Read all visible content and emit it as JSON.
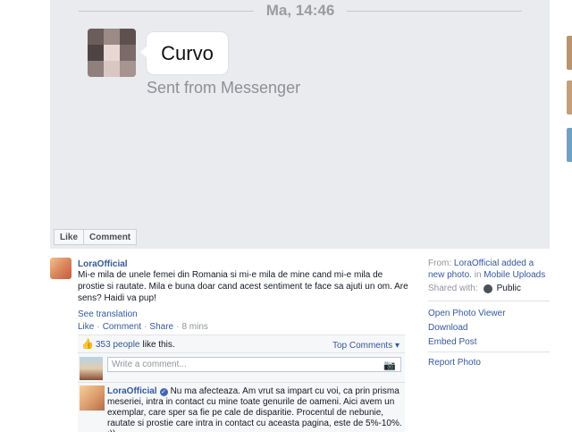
{
  "photo": {
    "time_stamp": "Ma, 14:46",
    "message_text": "Curvo",
    "sent_from": "Sent from Messenger",
    "like_label": "Like",
    "comment_label": "Comment"
  },
  "post": {
    "poster_name": "LoraOfficial",
    "text": "Mi-e mila de unele femei din Romania si mi-e mila de mine cand mi-e mila de prostie si rautate. Mila e buna doar cand acest sentiment te face sa ajuti un om. Are sens? Haidi va pup!",
    "see_translation": "See translation",
    "actions": {
      "like": "Like",
      "comment": "Comment",
      "share": "Share",
      "time": "8 mins"
    },
    "likes": {
      "count": "353 people",
      "suffix": "like this.",
      "top_comments": "Top Comments ▾"
    },
    "comment_placeholder": "Write a comment...",
    "comment": {
      "author": "LoraOfficial",
      "text": "Nu ma afecteaza. Am vrut sa impart cu voi, ca prin prisma meseriei, intra in contact cu mine toate genurile de oameni. Aici avem un exemplar, care sper sa fie pe cale de disparitie. Procentul de nebunie, rautate si prostie care intra in contact cu aceasta pagina, este de 5%-10%. :))"
    }
  },
  "info": {
    "from_label": "From:",
    "from_link": "LoraOfficial added a new photo.",
    "in_label": "in",
    "album_link": "Mobile Uploads",
    "shared_label": "Shared with:",
    "shared_value": "Public",
    "links": [
      "Open Photo Viewer",
      "Download",
      "Embed Post",
      "Report Photo"
    ]
  },
  "colors": {
    "link": "#365899",
    "stage_bg": "#e9ebee",
    "muted": "#90949c"
  }
}
